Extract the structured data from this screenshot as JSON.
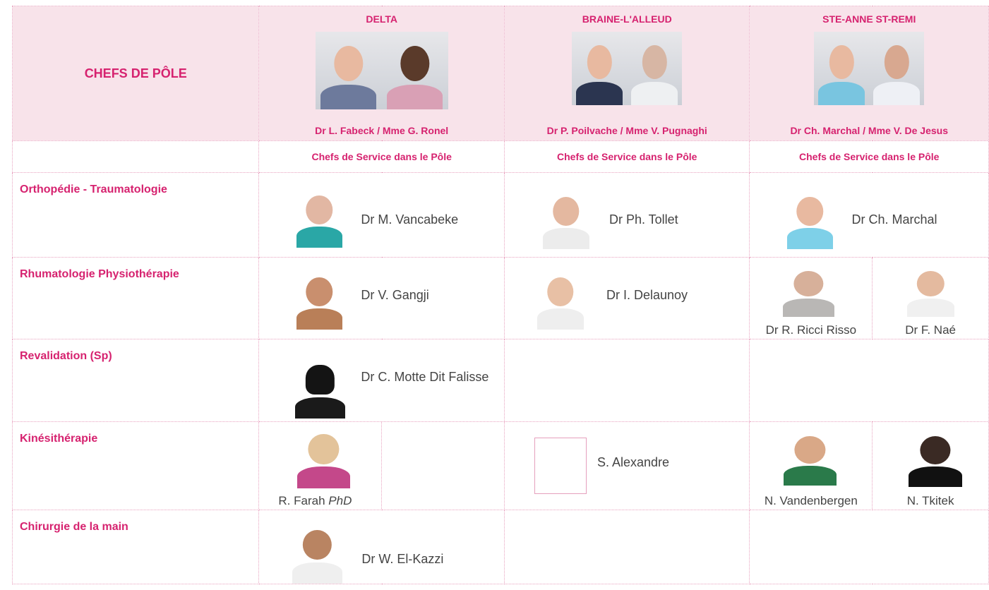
{
  "header": {
    "title": "CHEFS DE PÔLE",
    "sites": [
      {
        "name": "DELTA",
        "caption": "Dr L. Fabeck / Mme G. Ronel",
        "photos": [
          "doctor-photo",
          "doctor-photo"
        ]
      },
      {
        "name": "BRAINE-L'ALLEUD",
        "caption": "Dr P. Poilvache / Mme V. Pugnaghi",
        "photos": [
          "doctor-photo",
          "doctor-photo"
        ]
      },
      {
        "name": "STE-ANNE ST-REMI",
        "caption": "Dr Ch. Marchal / Mme V. De Jesus",
        "photos": [
          "doctor-photo",
          "doctor-photo"
        ]
      }
    ],
    "subheader": "Chefs de Service dans le Pôle"
  },
  "rows": [
    {
      "category": "Orthopédie - Traumatologie",
      "delta": "Dr M. Vancabeke",
      "braine": "Dr Ph. Tollet",
      "steanne": "Dr Ch. Marchal"
    },
    {
      "category": "Rhumatologie Physiothérapie",
      "delta": "Dr V. Gangji",
      "braine": "Dr I. Delaunoy",
      "steanne_a": "Dr R. Ricci Risso",
      "steanne_b": "Dr F. Naé"
    },
    {
      "category": "Revalidation (Sp)",
      "delta": "Dr C. Motte Dit Falisse"
    },
    {
      "category": "Kinésithérapie",
      "delta_name": "R. Farah",
      "delta_title": "PhD",
      "braine": "S. Alexandre",
      "steanne_a": "N. Vandenbergen",
      "steanne_b": "N. Tkitek"
    },
    {
      "category": "Chirurgie de la main",
      "delta": "Dr W. El-Kazzi"
    }
  ],
  "colors": {
    "accent": "#d6226f",
    "header_bg": "#f8e3ea",
    "border": "#e8a2bf"
  }
}
